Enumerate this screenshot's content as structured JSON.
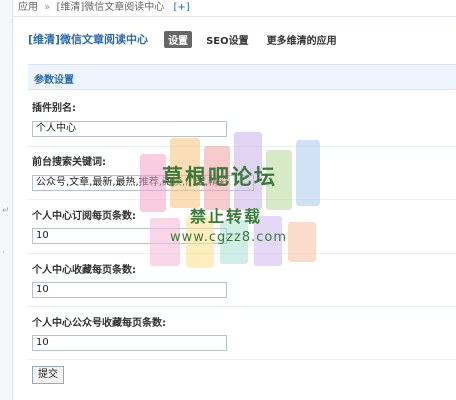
{
  "breadcrumb": {
    "app": "应用",
    "separator": "»",
    "current": "[维清]微信文章阅读中心",
    "add": "[+]"
  },
  "header": {
    "plugin_title": "[维清]微信文章阅读中心",
    "tabs": [
      "设置",
      "SEO设置",
      "更多维清的应用"
    ]
  },
  "section": {
    "title": "参数设置"
  },
  "fields": [
    {
      "label": "插件别名:",
      "value": "个人中心"
    },
    {
      "label": "前台搜索关键词:",
      "value": "公众号,文章,最新,最热,推荐,阅读,广告,精彩"
    },
    {
      "label": "个人中心订阅每页条数:",
      "value": "10"
    },
    {
      "label": "个人中心收藏每页条数:",
      "value": "10"
    },
    {
      "label": "个人中心公众号收藏每页条数:",
      "value": "10"
    }
  ],
  "submit_label": "提交",
  "watermark": {
    "line1": "草根吧论坛",
    "line2": "禁止转载",
    "line3": "www.cgzz8.com"
  },
  "colors": {
    "link": "#2b6ba8",
    "section_bg": "#eef4fb",
    "watermark_text": "#3a7a3a"
  }
}
